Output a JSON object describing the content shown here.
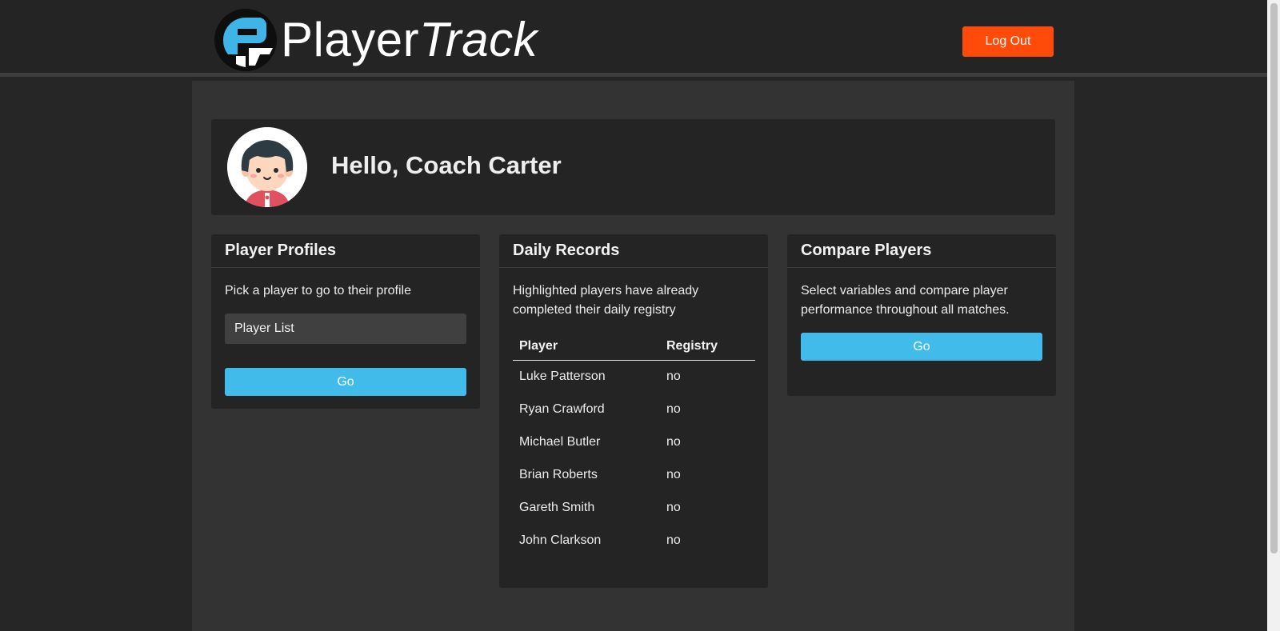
{
  "app": {
    "logo_text_plain": "Player",
    "logo_text_italic": "Track",
    "logout_label": "Log Out"
  },
  "greeting": {
    "text": "Hello, Coach Carter"
  },
  "player_profiles": {
    "title": "Player Profiles",
    "description": "Pick a player to go to their profile",
    "select_value": "Player List",
    "go_label": "Go"
  },
  "daily_records": {
    "title": "Daily Records",
    "description": "Highlighted players have already completed their daily registry",
    "columns": [
      "Player",
      "Registry"
    ],
    "rows": [
      {
        "player": "Luke Patterson",
        "registry": "no"
      },
      {
        "player": "Ryan Crawford",
        "registry": "no"
      },
      {
        "player": "Michael Butler",
        "registry": "no"
      },
      {
        "player": "Brian Roberts",
        "registry": "no"
      },
      {
        "player": "Gareth Smith",
        "registry": "no"
      },
      {
        "player": "John Clarkson",
        "registry": "no"
      }
    ]
  },
  "compare_players": {
    "title": "Compare Players",
    "description": "Select variables and compare player performance throughout all matches.",
    "go_label": "Go"
  },
  "colors": {
    "accent_orange": "#ff4b0a",
    "accent_blue": "#40bbea",
    "panel_bg": "#242424",
    "page_bg": "#333333"
  },
  "icons": [
    "playertrack-logo-icon",
    "coach-avatar-icon"
  ]
}
